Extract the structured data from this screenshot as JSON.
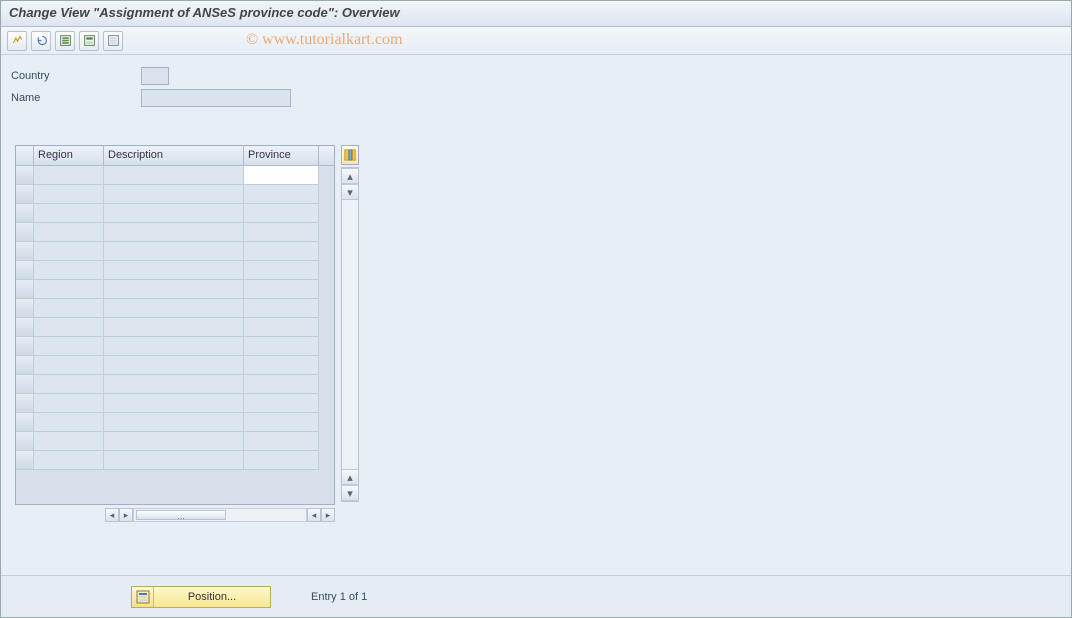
{
  "title": "Change View \"Assignment of ANSeS province code\": Overview",
  "watermark": "© www.tutorialkart.com",
  "toolbar": {
    "b1": "change-other-view",
    "b2": "undo",
    "b3": "select-all",
    "b4": "save",
    "b5": "deselect-all"
  },
  "form": {
    "country_label": "Country",
    "country_value": "",
    "name_label": "Name",
    "name_value": ""
  },
  "table": {
    "columns": {
      "region": "Region",
      "description": "Description",
      "province": "Province"
    },
    "rows": [
      {
        "region": "",
        "description": "",
        "province": ""
      },
      {
        "region": "",
        "description": "",
        "province": ""
      },
      {
        "region": "",
        "description": "",
        "province": ""
      },
      {
        "region": "",
        "description": "",
        "province": ""
      },
      {
        "region": "",
        "description": "",
        "province": ""
      },
      {
        "region": "",
        "description": "",
        "province": ""
      },
      {
        "region": "",
        "description": "",
        "province": ""
      },
      {
        "region": "",
        "description": "",
        "province": ""
      },
      {
        "region": "",
        "description": "",
        "province": ""
      },
      {
        "region": "",
        "description": "",
        "province": ""
      },
      {
        "region": "",
        "description": "",
        "province": ""
      },
      {
        "region": "",
        "description": "",
        "province": ""
      },
      {
        "region": "",
        "description": "",
        "province": ""
      },
      {
        "region": "",
        "description": "",
        "province": ""
      },
      {
        "region": "",
        "description": "",
        "province": ""
      },
      {
        "region": "",
        "description": "",
        "province": ""
      }
    ],
    "hscroll_thumb_label": "..."
  },
  "footer": {
    "position_label": "Position...",
    "entry_text": "Entry 1 of 1"
  }
}
